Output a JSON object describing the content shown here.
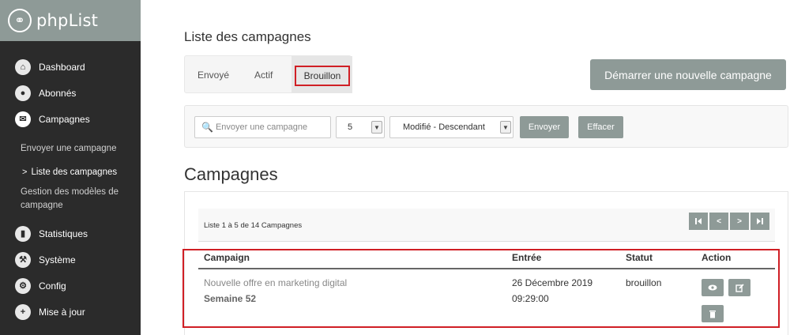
{
  "brand": {
    "name": "phpList"
  },
  "sidebar": {
    "items": [
      {
        "label": "Dashboard",
        "icon": "home-icon",
        "glyph": "⌂"
      },
      {
        "label": "Abonnés",
        "icon": "user-icon",
        "glyph": "●"
      },
      {
        "label": "Campagnes",
        "icon": "envelope-icon",
        "glyph": "✉"
      }
    ],
    "subitems": [
      {
        "label": "Envoyer une campagne"
      },
      {
        "label": "Liste des campagnes",
        "current": true,
        "chevron": ">"
      },
      {
        "label": "Gestion des modèles de campagne"
      }
    ],
    "items_after": [
      {
        "label": "Statistiques",
        "icon": "bar-chart-icon",
        "glyph": "▮"
      },
      {
        "label": "Système",
        "icon": "wrench-icon",
        "glyph": "⚒"
      },
      {
        "label": "Config",
        "icon": "gear-icon",
        "glyph": "⚙"
      },
      {
        "label": "Mise à jour",
        "icon": "plus-icon",
        "glyph": "+"
      }
    ]
  },
  "page": {
    "title": "Liste des campagnes",
    "section_title": "Campagnes"
  },
  "tabs": [
    {
      "label": "Envoyé"
    },
    {
      "label": "Actif"
    },
    {
      "label": "Brouillon",
      "active": true
    }
  ],
  "start_button": {
    "label": "Démarrer une nouvelle campagne"
  },
  "filter": {
    "search_placeholder": "Envoyer une campagne",
    "count_value": "5",
    "sort_value": "Modifié - Descendant",
    "submit_label": "Envoyer",
    "clear_label": "Effacer"
  },
  "listing": {
    "info": "Liste 1 à 5 de 14 Campagnes",
    "pager": {
      "first": "⏮",
      "prev": "<",
      "next": ">",
      "last": "⏭"
    }
  },
  "table": {
    "headers": [
      "Campaign",
      "Entrée",
      "Statut",
      "Action"
    ],
    "rows": [
      {
        "name": "Nouvelle offre en marketing digital",
        "subname": "Semaine 52",
        "date": "26 Décembre 2019",
        "time": "09:29:00",
        "status": "brouillon"
      }
    ]
  },
  "colors": {
    "sidebar": "#2b2b2b",
    "accent": "#8e9a97",
    "highlight": "#d01f25"
  }
}
